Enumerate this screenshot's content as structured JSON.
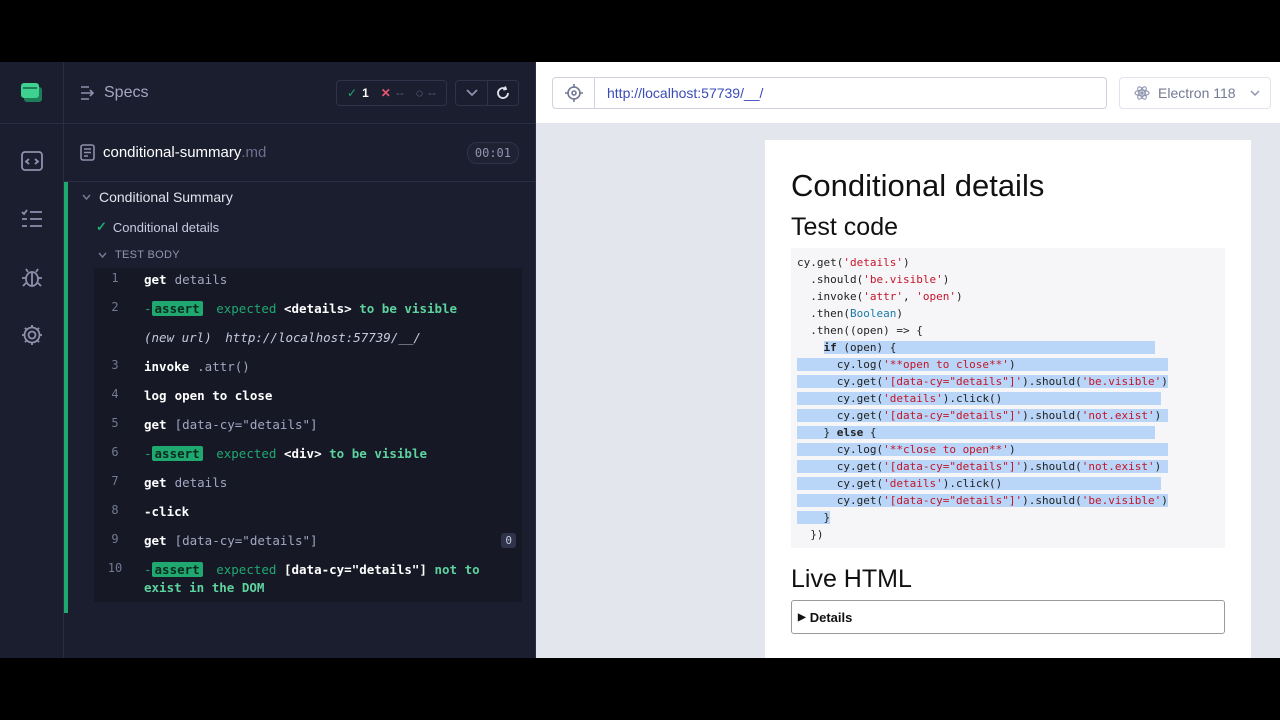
{
  "reporter": {
    "title": "Specs",
    "stats": {
      "passed": "1",
      "failed": "--",
      "pending": "--"
    },
    "spec": {
      "name": "conditional-summary",
      "ext": ".md",
      "duration": "00:01"
    },
    "suite_title": "Conditional Summary",
    "test_title": "Conditional details",
    "body_title": "TEST BODY",
    "commands": [
      {
        "num": "1",
        "name": "get",
        "msg": "details"
      },
      {
        "num": "2",
        "pill": "assert",
        "parts": [
          "expected",
          "<details>",
          "to be",
          "visible"
        ]
      },
      {
        "num": "",
        "url_label": "(new url)",
        "url": "http://localhost:57739/__/"
      },
      {
        "num": "3",
        "name": "invoke",
        "msg": ".attr()"
      },
      {
        "num": "4",
        "name": "log",
        "msg": "open to close"
      },
      {
        "num": "5",
        "name": "get",
        "msg": "[data-cy=\"details\"]"
      },
      {
        "num": "6",
        "pill": "assert",
        "parts": [
          "expected",
          "<div>",
          "to be",
          "visible"
        ]
      },
      {
        "num": "7",
        "name": "get",
        "msg": "details"
      },
      {
        "num": "8",
        "name": "-click",
        "msg": ""
      },
      {
        "num": "9",
        "name": "get",
        "msg": "[data-cy=\"details\"]",
        "badge": "0"
      },
      {
        "num": "10",
        "pill": "assert",
        "parts": [
          "expected",
          "[data-cy=\"details\"]",
          "not to",
          "exist in the DOM"
        ]
      }
    ]
  },
  "aut": {
    "url": "http://localhost:57739/__/",
    "browser": "Electron 118",
    "page_title": "Conditional details",
    "test_code_heading": "Test code",
    "live_heading": "Live HTML",
    "details_label": "Details"
  },
  "colors": {
    "pass": "#1fa971",
    "url": "#3a4bb8",
    "highlight": "#b9d5f7"
  },
  "icons": [
    "app-logo-icon",
    "spec-list-icon",
    "runs-icon",
    "debug-icon",
    "settings-icon",
    "selector-playground-icon",
    "electron-icon"
  ]
}
